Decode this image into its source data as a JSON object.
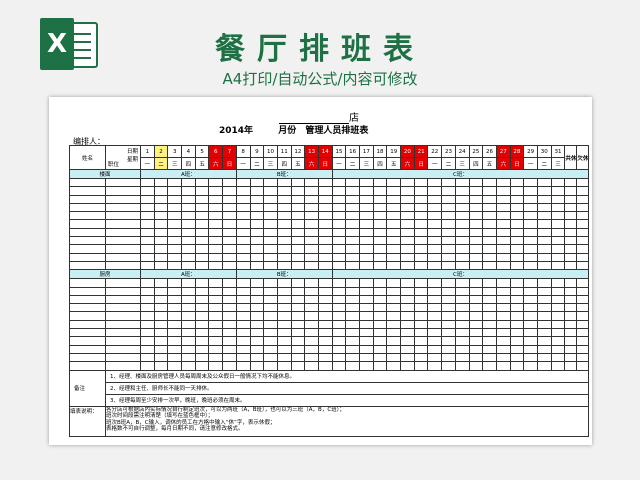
{
  "banner": {
    "title": "餐厅排班表",
    "subtitle": "A4打印/自动公式/内容可修改",
    "logo_letter": "X",
    "brand_color": "#1e7145"
  },
  "doc": {
    "shop_suffix": "店",
    "year_label": "2014年",
    "month_label": "月份",
    "table_title": "管理人员排班表",
    "prepared_by": "编排人：",
    "col_name": "姓名",
    "diag_date": "日期",
    "diag_week": "星期",
    "diag_post": "职位",
    "days": [
      "1",
      "2",
      "3",
      "4",
      "5",
      "6",
      "7",
      "8",
      "9",
      "10",
      "11",
      "12",
      "13",
      "14",
      "15",
      "16",
      "17",
      "18",
      "19",
      "20",
      "21",
      "22",
      "23",
      "24",
      "25",
      "26",
      "27",
      "28",
      "29",
      "30",
      "31"
    ],
    "weekdays": [
      "一",
      "二",
      "三",
      "四",
      "五",
      "六",
      "日",
      "一",
      "二",
      "三",
      "四",
      "五",
      "六",
      "日",
      "一",
      "二",
      "三",
      "四",
      "五",
      "六",
      "日",
      "一",
      "二",
      "三",
      "四",
      "五",
      "六",
      "日",
      "一",
      "二",
      "三"
    ],
    "weekend_columns": [
      6,
      7,
      13,
      14,
      20,
      21,
      27,
      28
    ],
    "highlight_day": 2,
    "col_total": "共休",
    "col_owed": "欠休",
    "section1": {
      "name": "楼面",
      "shift_a": "A班：",
      "shift_b": "B班：",
      "shift_c": "C班："
    },
    "section2": {
      "name": "厨房",
      "shift_a": "A班：",
      "shift_b": "B班：",
      "shift_c": "C班："
    },
    "notes_label": "备注",
    "notes": [
      "1、经理、楼面及厨房管理人员每周周末及公众假日一般情况下均不能休息。",
      "2、经理和主任、厨师长不能同一天排休。",
      "3、经理每周至少安排一次早，晚班，晚班必须在周末。"
    ],
    "fill_label": "填表说明：",
    "fill_lines": [
      "各分店可根据店内实际情况自行制定班次，可以为两班（A，B班），也可以为三班（A，B，C班）；",
      "班次时间段需注明清楚（填写在蓝色框中）；",
      "班次B班A，B，C输入，调休的员工在方格中输入“休”字，表示休假；",
      "表格数不可自行调整，每月日期不同，请注意修改格式。"
    ]
  },
  "colors": {
    "weekend_red": "#e30000",
    "highlight_yellow": "#fff27f",
    "section_cyan": "#c8f0f4"
  }
}
